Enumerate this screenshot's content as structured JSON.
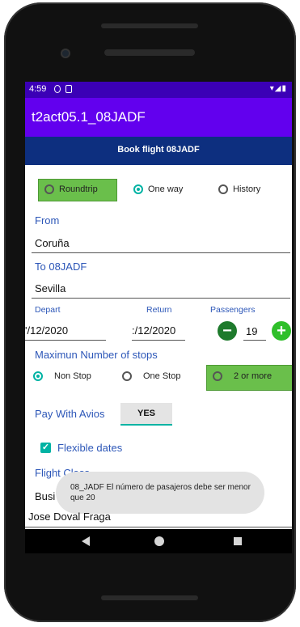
{
  "status_bar": {
    "time": "4:59",
    "right_icons": "▾◢▮"
  },
  "app_bar": {
    "title": "t2act05.1_08JADF"
  },
  "banner": {
    "title": "Book flight 08JADF"
  },
  "trip_type": {
    "options": [
      {
        "label": "Roundtrip",
        "selected": false
      },
      {
        "label": "One way",
        "selected": true
      },
      {
        "label": "History",
        "selected": false
      }
    ]
  },
  "from": {
    "label": "From",
    "value": "Coruña"
  },
  "to": {
    "label": "To 08JADF",
    "value": "Sevilla"
  },
  "dates": {
    "depart_label": "Depart",
    "depart_value": "'/12/2020",
    "return_label": "Return",
    "return_value": ":/12/2020"
  },
  "passengers": {
    "label": "Passengers",
    "value": "19",
    "minus": "−",
    "plus": "+"
  },
  "stops": {
    "label": "Maximun Number of stops",
    "options": [
      {
        "label": "Non Stop",
        "selected": true
      },
      {
        "label": "One Stop",
        "selected": false
      },
      {
        "label": "2 or more",
        "selected": false
      }
    ]
  },
  "avios": {
    "label": "Pay With Avios",
    "toggle": "YES"
  },
  "flexible": {
    "label": "Flexible dates",
    "checked": true,
    "check": "✓"
  },
  "flight_class": {
    "label": "Flight Class",
    "value_partial": "Busi"
  },
  "name": {
    "value": "Jose Doval Fraga"
  },
  "toast": {
    "message": "08_JADF El número de pasajeros debe ser menor que 20"
  },
  "colors": {
    "status_bar": "#3b00b6",
    "app_bar": "#6200ee",
    "banner": "#0d2f7f",
    "accent": "#00b3a4",
    "green": "#6abf4b",
    "label": "#2d57b8"
  }
}
